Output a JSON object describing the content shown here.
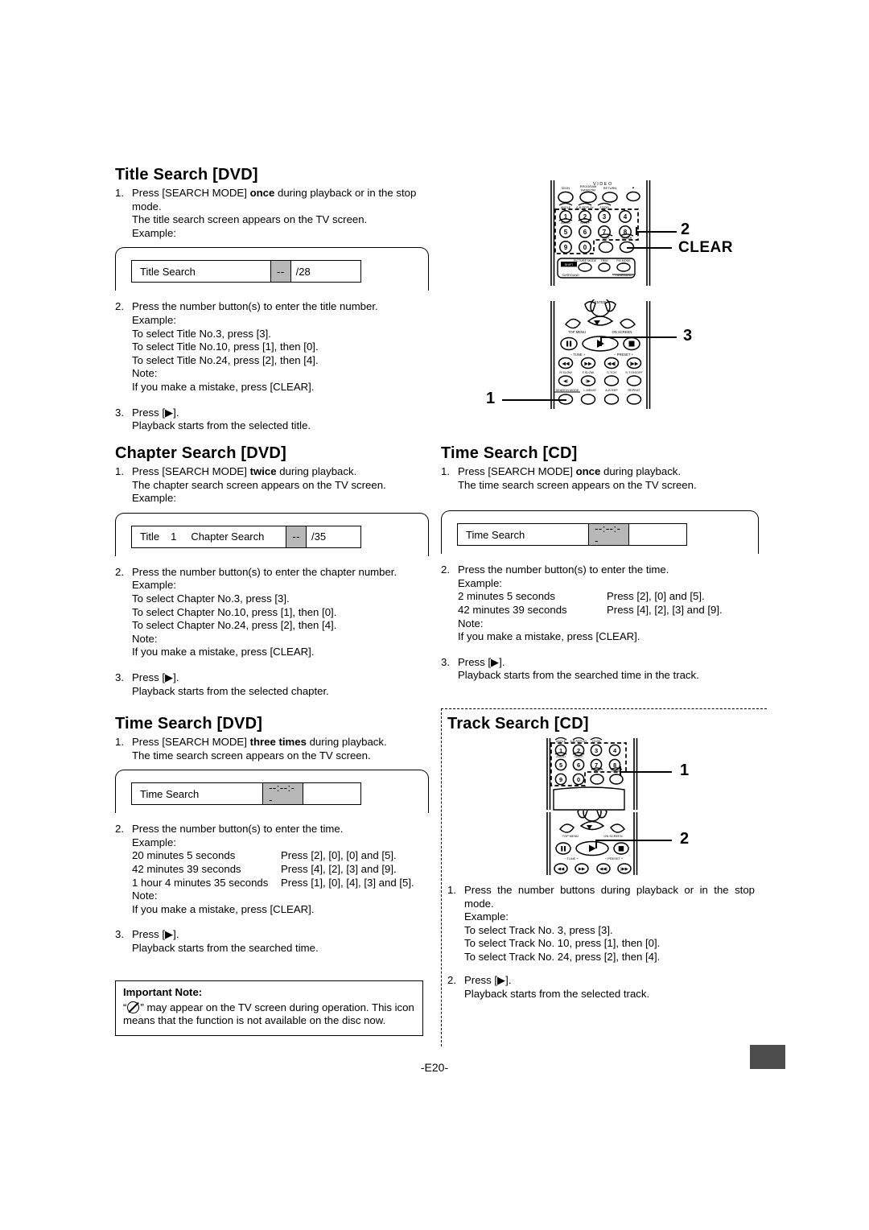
{
  "page": {
    "footer_label": "-E20-",
    "accent_tab_color": "#4d4d4d"
  },
  "sections": {
    "title_search_dvd": {
      "heading": "Title Search [DVD]",
      "steps": [
        {
          "num": "1.",
          "lines": [
            "Press [SEARCH MODE] once during playback or in the stop",
            "mode.",
            "The title search screen appears on the TV screen.",
            "Example:"
          ],
          "bold_word": "once"
        },
        {
          "num": "2.",
          "lines": [
            "Press the number button(s) to enter the title number.",
            "Example:",
            "To select Title No.3, press [3].",
            "To select Title No.10, press [1], then [0].",
            "To select Title No.24, press [2], then [4].",
            "Note:",
            "If you make a mistake, press [CLEAR]."
          ]
        },
        {
          "num": "3.",
          "lines": [
            "Press [▶].",
            "Playback starts from the selected title."
          ]
        }
      ],
      "tv_screen": {
        "label": "Title Search",
        "value": "--",
        "suffix": "/28"
      }
    },
    "chapter_search_dvd": {
      "heading": "Chapter Search [DVD]",
      "steps": [
        {
          "num": "1.",
          "lines": [
            "Press [SEARCH MODE] twice during playback.",
            "The chapter search screen appears on the TV screen.",
            "Example:"
          ],
          "bold_word": "twice"
        },
        {
          "num": "2.",
          "lines": [
            "Press the number button(s) to enter the chapter number.",
            "Example:",
            "To select Chapter No.3, press [3].",
            "To select Chapter No.10, press [1], then [0].",
            "To select Chapter No.24, press [2], then [4].",
            "Note:",
            "If you make a mistake, press [CLEAR]."
          ]
        },
        {
          "num": "3.",
          "lines": [
            "Press [▶].",
            "Playback starts from the selected chapter."
          ]
        }
      ],
      "tv_screen": {
        "prefix_label": "Title",
        "prefix_value": "1",
        "label": "Chapter Search",
        "value": "--",
        "suffix": "/35"
      }
    },
    "time_search_dvd": {
      "heading": "Time Search [DVD]",
      "steps": [
        {
          "num": "1.",
          "lines": [
            "Press [SEARCH MODE] three times during playback.",
            "The time search screen appears on the TV screen."
          ],
          "bold_word": "three times"
        },
        {
          "num": "2.",
          "intro": "Press the number button(s) to enter the time.",
          "example_label": "Example:",
          "examples": [
            {
              "desc": "20 minutes 5 seconds",
              "action": "Press [2], [0], [0] and [5]."
            },
            {
              "desc": "42 minutes 39 seconds",
              "action": "Press [4], [2], [3] and [9]."
            },
            {
              "desc": "1 hour 4 minutes 35 seconds",
              "action": "Press [1], [0], [4], [3] and [5]."
            }
          ],
          "note_label": "Note:",
          "note": "If you make a mistake, press [CLEAR]."
        },
        {
          "num": "3.",
          "lines": [
            "Press [▶].",
            "Playback starts from the searched time."
          ]
        }
      ],
      "tv_screen": {
        "label": "Time Search",
        "value": "--:--:--"
      }
    },
    "important_note": {
      "title": "Important Note:",
      "text_before": "“",
      "text_after": "” may appear on the TV screen during operation. This icon means that the function is not available on the disc now."
    },
    "time_search_cd": {
      "heading": "Time Search [CD]",
      "steps": [
        {
          "num": "1.",
          "lines": [
            "Press [SEARCH MODE] once during playback.",
            "The time search screen appears on the TV screen."
          ],
          "bold_word": "once"
        },
        {
          "num": "2.",
          "intro": "Press the number button(s) to enter the time.",
          "example_label": "Example:",
          "examples": [
            {
              "desc": "2 minutes 5 seconds",
              "action": "Press [2], [0] and [5]."
            },
            {
              "desc": "42 minutes 39 seconds",
              "action": "Press [4], [2], [3] and [9]."
            }
          ],
          "note_label": "Note:",
          "note": "If you make a mistake, press [CLEAR]."
        },
        {
          "num": "3.",
          "lines": [
            "Press [▶].",
            "Playback starts from the searched time in the track."
          ]
        }
      ],
      "tv_screen": {
        "label": "Time Search",
        "value": "--:--:--"
      }
    },
    "track_search_cd": {
      "heading": "Track Search [CD]",
      "steps": [
        {
          "num": "1.",
          "lines": [
            "Press the number buttons during playback or in the stop",
            "mode.",
            "Example:",
            "To select Track No. 3, press [3].",
            "To select Track No. 10, press [1], then [0].",
            "To select Track No. 24, press [2], then [4]."
          ]
        },
        {
          "num": "2.",
          "lines": [
            "Press [▶].",
            "Playback starts from the selected track."
          ]
        }
      ]
    }
  },
  "remote_figures": {
    "top_figure": {
      "brand_text": "VIDEO",
      "callouts": [
        {
          "id": "callout-2",
          "label": "2"
        },
        {
          "id": "callout-clear",
          "label": "CLEAR"
        },
        {
          "id": "callout-3",
          "label": "3"
        },
        {
          "id": "callout-1",
          "label": "1"
        }
      ],
      "numeric_keys": [
        "1",
        "2",
        "3",
        "4",
        "5",
        "6",
        "7",
        "8",
        "9",
        "0"
      ],
      "key_sublabels": {
        "power": "⏻/ON",
        "program": "PROGRAM",
        "random": "RANDOM",
        "return": "RETURN",
        "eject": "▲",
        "angle": "ANGLE",
        "ab_replay": "A-B REPLAY",
        "zoom": "ZOOM",
        "audio": "AUDIO",
        "sleep": "SLEEP",
        "text": "TEXT",
        "clear": "CLEAR",
        "shift": "SHIFT",
        "picture_mode": "PICTURE MODE",
        "trim": "TRIM",
        "fm_mode": "FM MODE",
        "surround": "SURROUND",
        "tune_band": "TUNE/BAND"
      }
    },
    "bottom_figure": {
      "key_sublabels": {
        "enter": "ENTER",
        "top_menu": "TOP MENU",
        "on_screen": "ON SCREEN",
        "tune": "− TUNE +",
        "preset": "− PRESET +",
        "r_slow": "R.SLOW",
        "f_slow": "F.SLOW",
        "s_tch": "S.TCH",
        "st_on_off": "S.T.ON/OFF",
        "search_mode": "SEARCH MODE",
        "l_memo": "L.MEMO",
        "ab_rep": "A-B REP",
        "repeat": "REPEAT"
      }
    },
    "track_figure": {
      "callouts": [
        {
          "id": "track-callout-1",
          "label": "1"
        },
        {
          "id": "track-callout-2",
          "label": "2"
        }
      ]
    }
  }
}
